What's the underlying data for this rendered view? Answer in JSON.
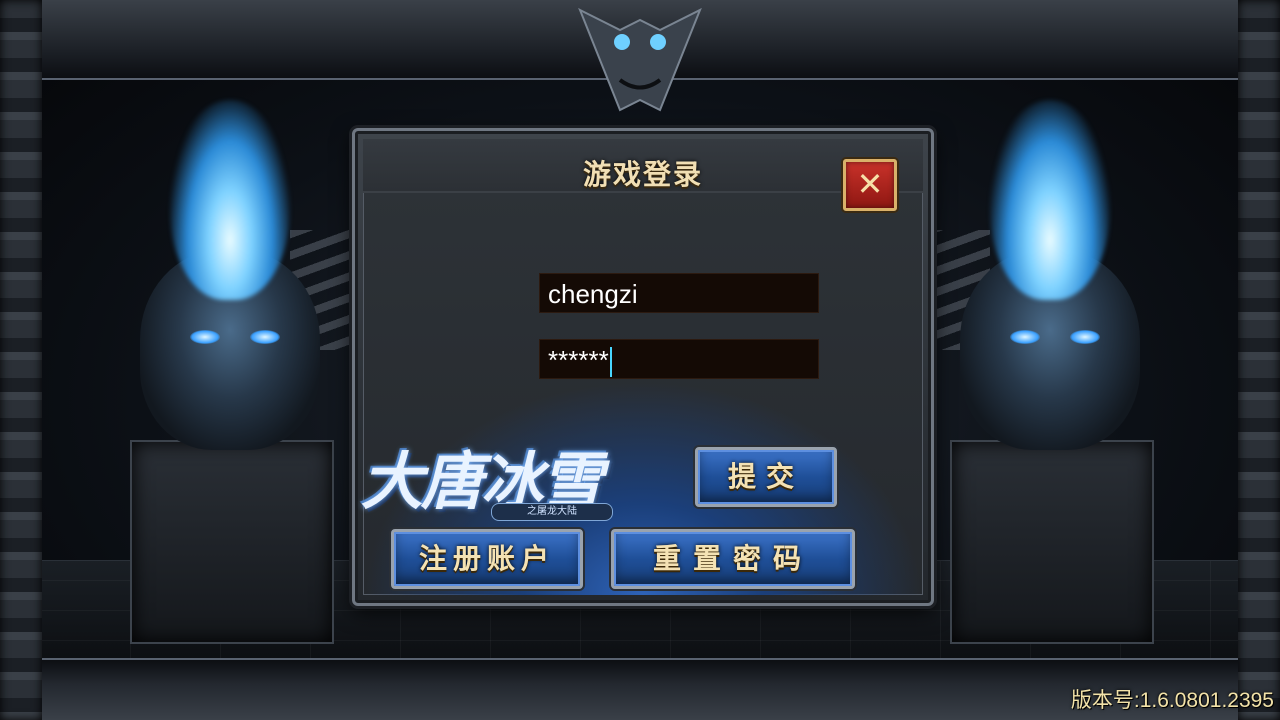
{
  "login_dialog": {
    "title": "游戏登录",
    "close_symbol": "✕",
    "username_value": "chengzi",
    "password_value": "******",
    "submit_label": "提交",
    "register_label": "注册账户",
    "reset_password_label": "重置密码"
  },
  "logo": {
    "title": "大唐冰雪",
    "subtitle": "之屠龙大陆"
  },
  "footer": {
    "version_text": "版本号:1.6.0801.2395"
  },
  "colors": {
    "button_text": "#f4e2b4",
    "button_blue": "#1f4f98",
    "close_red": "#c9322a",
    "flame_blue": "#7fd2ff"
  },
  "icons": {
    "close": "close-icon"
  }
}
